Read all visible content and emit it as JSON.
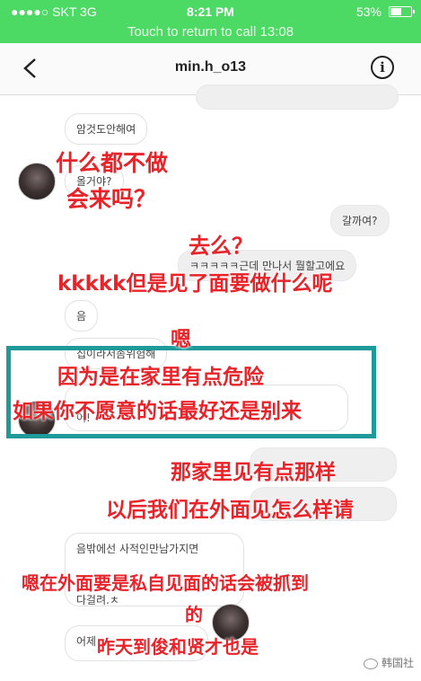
{
  "status_bar": {
    "carrier": "●●●●○ SKT  3G",
    "time": "8:21 PM",
    "battery": "53%"
  },
  "call_banner": "Touch to return to call 13:08",
  "header": {
    "title": "min.h_o13"
  },
  "messages": [
    {
      "text": "암것도안해여"
    },
    {
      "text": "올거야?"
    },
    {
      "text": "갈까여?"
    },
    {
      "text": "ㅋㅋㅋㅋㅋ근데 만나서 뭘할고에요"
    },
    {
      "text": "음"
    },
    {
      "text": "집이라서좀위험해"
    },
    {
      "text": "어!"
    },
    {
      "text": "음밖에선 사적인만남가지면"
    },
    {
      "text": "다걸려.ㅊ"
    },
    {
      "text": "어제"
    }
  ],
  "annotations": {
    "a1": "什么都不做",
    "a2": "会来吗？",
    "a3": "去么？",
    "a4": "kkkkk但是见了面要做什么呢",
    "a5": "嗯",
    "a6": "因为是在家里有点危险",
    "a7": "如果你不愿意的话最好还是别来",
    "a8": "那家里见有点那样",
    "a9": "以后我们在外面见怎么样请",
    "a10": "嗯在外面要是私自见面的话会被抓到",
    "a11": "的",
    "a12": "昨天到俊和贤才也是"
  },
  "watermark": "韩国社",
  "colors": {
    "status_green": "#4cd964",
    "annotation_red": "#e8242a",
    "highlight_teal": "#1e9a9a"
  }
}
